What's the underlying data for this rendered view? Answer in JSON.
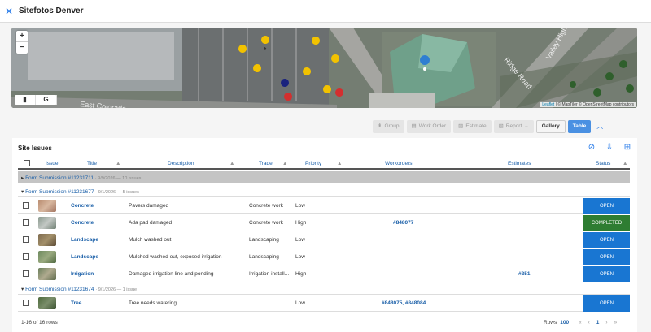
{
  "header": {
    "title": "Sitefotos Denver",
    "close_icon": "close-icon"
  },
  "map": {
    "zoom_in": "+",
    "zoom_out": "−",
    "toggle": [
      "map-icon",
      "G"
    ],
    "labels": [
      "East Colorado",
      "Ridge Road",
      "Valley Highway"
    ],
    "attribution_link": "Leaflet",
    "attribution_text": " | © MapTiler © OpenStreetMap contributors"
  },
  "toolbar": {
    "group": "Group",
    "work_order": "Work Order",
    "estimate": "Estimate",
    "report": "Report",
    "gallery": "Gallery",
    "table": "Table"
  },
  "panel": {
    "title": "Site Issues"
  },
  "columns": [
    "Issue",
    "Title",
    "Description",
    "Trade",
    "Priority",
    "Workorders",
    "Estimates",
    "Status"
  ],
  "groups": [
    {
      "label": "Form Submission #11231711",
      "meta": "· 9/9/2026 — 10 issues"
    },
    {
      "label": "Form Submission #11231677",
      "meta": "· 9/1/2026 — 5 issues"
    },
    {
      "label": "Form Submission #11231674",
      "meta": "· 9/1/2026 — 1 issue"
    }
  ],
  "rows": [
    {
      "title": "Concrete",
      "description": "Pavers damaged",
      "trade": "Concrete work",
      "priority": "Low",
      "workorders": "",
      "estimates": "",
      "status": "OPEN"
    },
    {
      "title": "Concrete",
      "description": "Ada pad damaged",
      "trade": "Concrete work",
      "priority": "High",
      "workorders": "#848077",
      "estimates": "",
      "status": "COMPLETED"
    },
    {
      "title": "Landscape",
      "description": "Mulch washed out",
      "trade": "Landscaping",
      "priority": "Low",
      "workorders": "",
      "estimates": "",
      "status": "OPEN"
    },
    {
      "title": "Landscape",
      "description": "Mulched washed out, exposed irrigation",
      "trade": "Landscaping",
      "priority": "Low",
      "workorders": "",
      "estimates": "",
      "status": "OPEN"
    },
    {
      "title": "Irrigation",
      "description": "Damaged irrigation line and ponding",
      "trade": "Irrigation install...",
      "priority": "High",
      "workorders": "",
      "estimates": "#251",
      "status": "OPEN"
    },
    {
      "title": "Tree",
      "description": "Tree needs watering",
      "trade": "",
      "priority": "Low",
      "workorders": "#848075, #848084",
      "estimates": "",
      "status": "OPEN"
    }
  ],
  "footer": {
    "count": "1-16 of 16 rows",
    "rows_label": "Rows",
    "rows_value": "100",
    "page": "1"
  }
}
